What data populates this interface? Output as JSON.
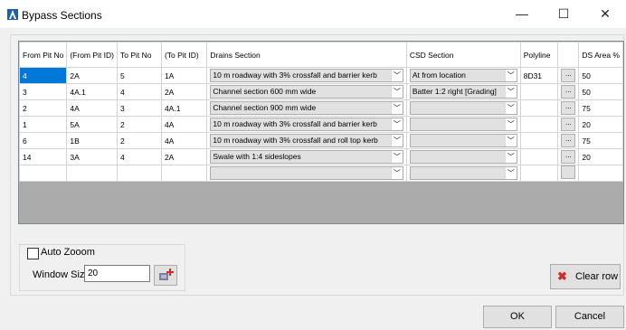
{
  "window": {
    "title": "Bypass Sections",
    "minimize_glyph": "—",
    "maximize_glyph": "☐",
    "close_glyph": "✕",
    "app_icon": "autocad-a-icon"
  },
  "grid": {
    "columns": [
      "From Pit No",
      "(From Pit ID)",
      "To Pit No",
      "(To Pit ID)",
      "Drains Section",
      "CSD Section",
      "Polyline",
      "",
      "DS Area %"
    ],
    "ellipsis": "...",
    "rows": [
      {
        "from_pit_no": "4",
        "from_pit_id": "2A",
        "to_pit_no": "5",
        "to_pit_id": "1A",
        "drains_section": "10 m roadway with 3% crossfall and barrier kerb",
        "csd_section": "At from location",
        "polyline": "8D31",
        "ds_area": "50"
      },
      {
        "from_pit_no": "3",
        "from_pit_id": "4A.1",
        "to_pit_no": "4",
        "to_pit_id": "2A",
        "drains_section": "Channel section 600 mm wide",
        "csd_section": "Batter 1:2 right [Grading]",
        "polyline": "",
        "ds_area": "50"
      },
      {
        "from_pit_no": "2",
        "from_pit_id": "4A",
        "to_pit_no": "3",
        "to_pit_id": "4A.1",
        "drains_section": "Channel section 900 mm wide",
        "csd_section": "",
        "polyline": "",
        "ds_area": "75"
      },
      {
        "from_pit_no": "1",
        "from_pit_id": "5A",
        "to_pit_no": "2",
        "to_pit_id": "4A",
        "drains_section": "10 m roadway with 3% crossfall and barrier kerb",
        "csd_section": "",
        "polyline": "",
        "ds_area": "20"
      },
      {
        "from_pit_no": "6",
        "from_pit_id": "1B",
        "to_pit_no": "2",
        "to_pit_id": "4A",
        "drains_section": "10 m roadway with 3% crossfall and roll top kerb",
        "csd_section": "",
        "polyline": "",
        "ds_area": "75"
      },
      {
        "from_pit_no": "14",
        "from_pit_id": "3A",
        "to_pit_no": "4",
        "to_pit_id": "2A",
        "drains_section": "Swale with 1:4 sideslopes",
        "csd_section": "",
        "polyline": "",
        "ds_area": "20"
      }
    ]
  },
  "options": {
    "auto_zoom_label": "Auto Zooom",
    "auto_zoom_checked": false,
    "window_size_label": "Window Size",
    "window_size_value": "20"
  },
  "buttons": {
    "clear_row": "Clear row",
    "ok": "OK",
    "cancel": "Cancel"
  }
}
